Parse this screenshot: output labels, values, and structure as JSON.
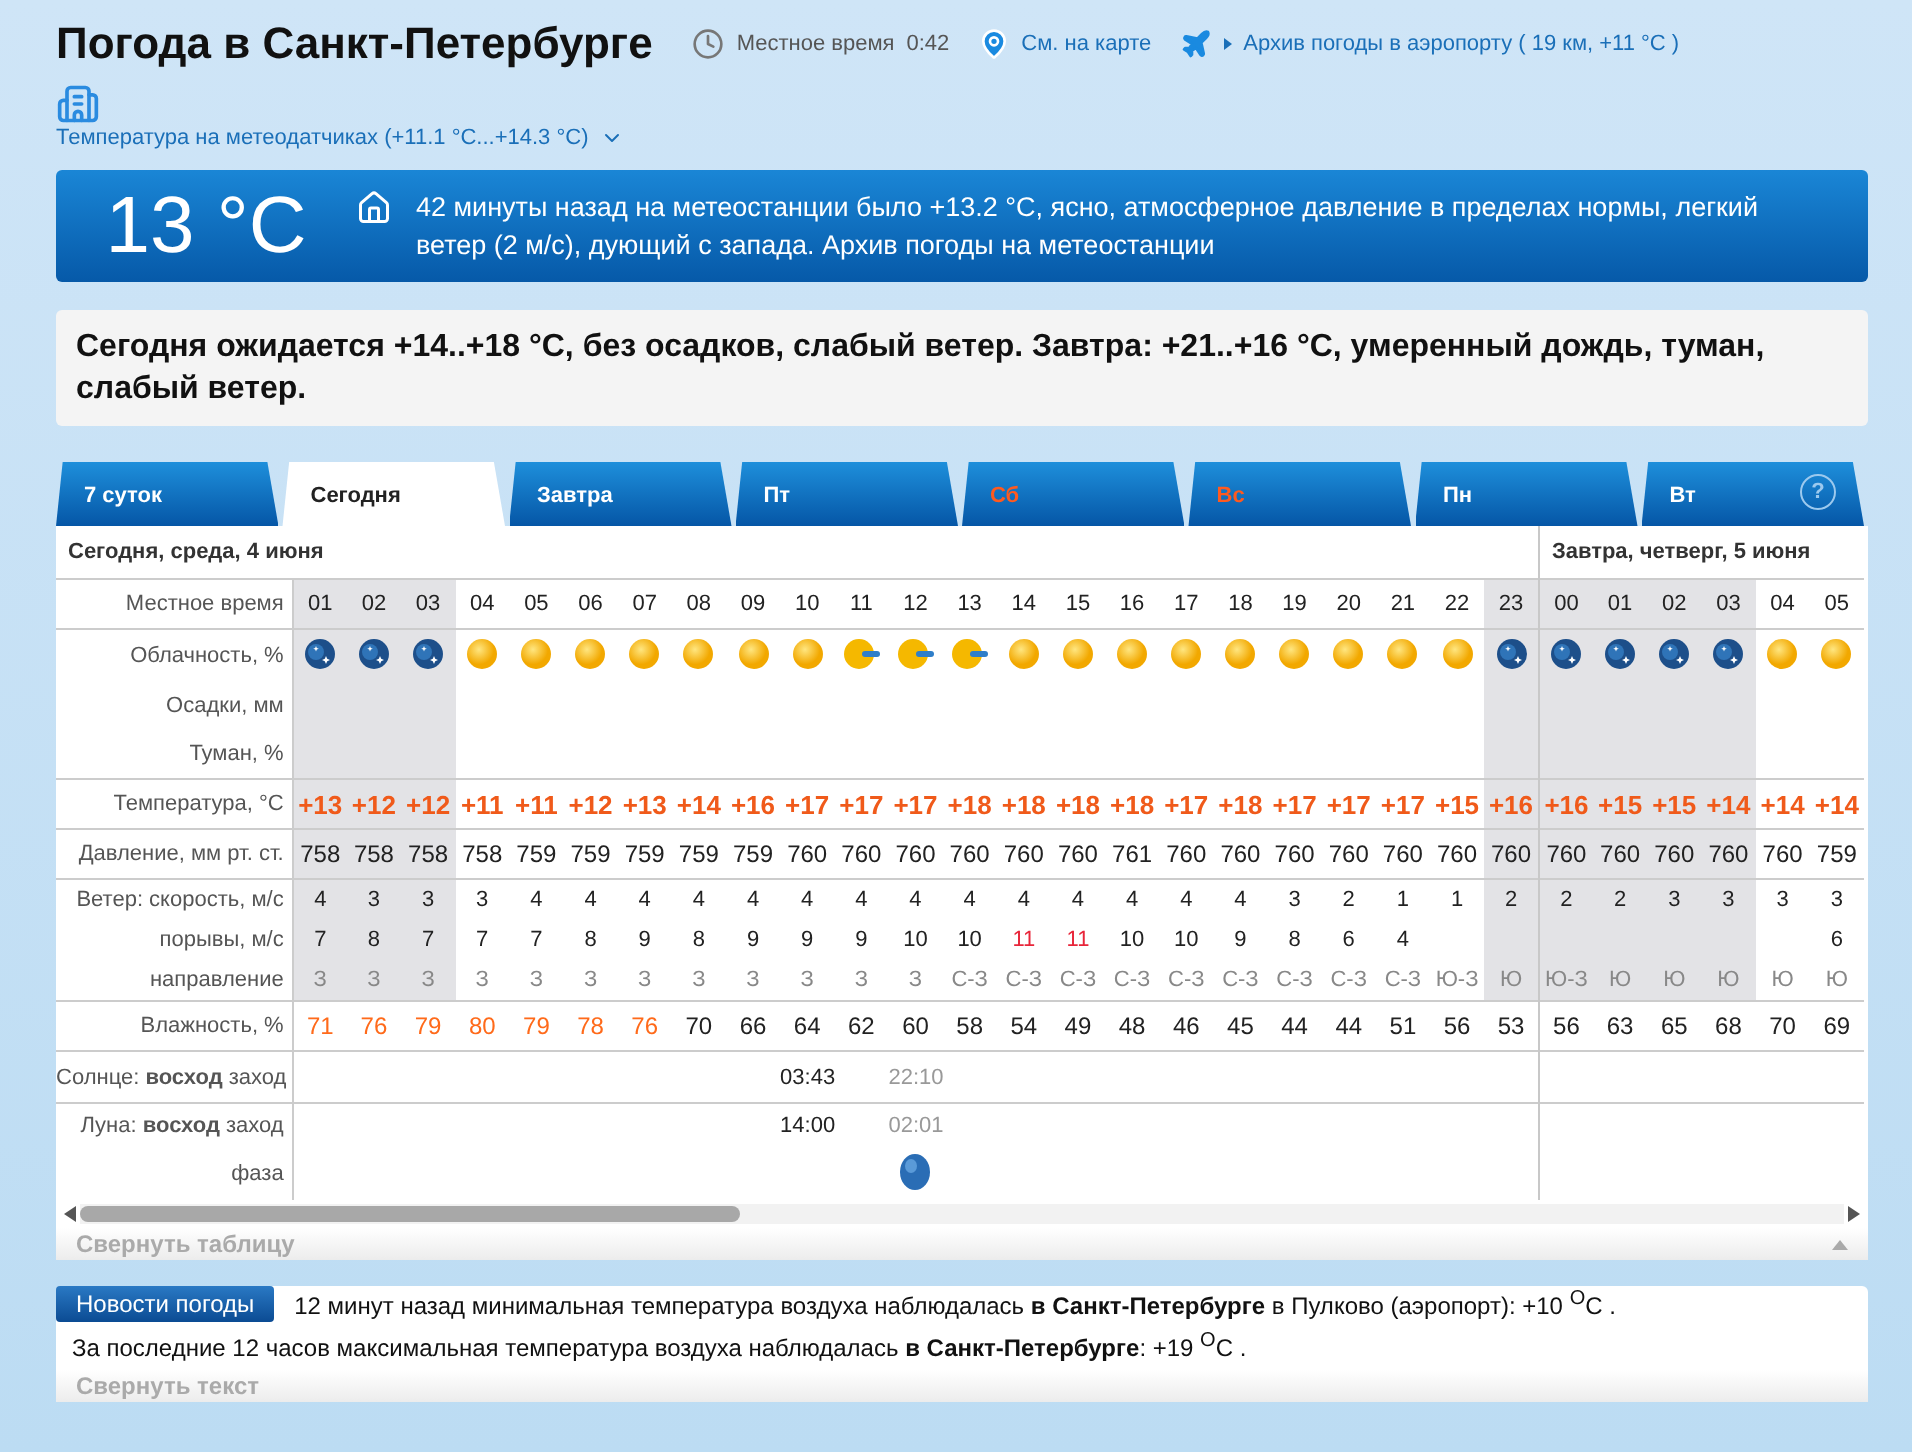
{
  "header": {
    "title": "Погода в Санкт-Петербурге",
    "local_time_label": "Местное время",
    "local_time": "0:42",
    "map_link": "См. на карте",
    "airport_link": "Архив погоды в аэропорту ( 19 км, +11 °C )",
    "sensors_link": "Температура на метеодатчиках (+11.1 °C...+14.3 °C)"
  },
  "current": {
    "temperature": "13 °C",
    "text": "42 минуты назад на метеостанции было +13.2 °C, ясно, атмосферное давление в пределах нормы, легкий ветер (2 м/с), дующий с запада.",
    "link": "Архив погоды на метеостанции"
  },
  "summary": "Сегодня ожидается +14..+18 °C, без осадков, слабый ветер. Завтра: +21..+16 °C, умеренный дождь, туман, слабый ветер.",
  "tabs": [
    {
      "label": "7 суток",
      "selected": false,
      "weekend": false
    },
    {
      "label": "Сегодня",
      "selected": true,
      "weekend": false
    },
    {
      "label": "Завтра",
      "selected": false,
      "weekend": false
    },
    {
      "label": "Пт",
      "selected": false,
      "weekend": false
    },
    {
      "label": "Сб",
      "selected": false,
      "weekend": true
    },
    {
      "label": "Вс",
      "selected": false,
      "weekend": true
    },
    {
      "label": "Пн",
      "selected": false,
      "weekend": false
    },
    {
      "label": "Вт",
      "selected": false,
      "weekend": false
    }
  ],
  "help_label": "?",
  "row_labels": {
    "time": "Местное время",
    "clouds": "Облачность, %",
    "precip": "Осадки, мм",
    "fog": "Туман, %",
    "temperature": "Температура, °C",
    "pressure": "Давление, мм рт. ст.",
    "wind": "Ветер: скорость, м/с",
    "gusts": "порывы, м/с",
    "direction": "направление",
    "humidity": "Влажность, %",
    "sun": "Солнце: **восход** заход",
    "moon": "Луна: **восход** заход",
    "phase": "фаза"
  },
  "days": [
    {
      "title": "Сегодня, среда, 4 июня",
      "columns": [
        {
          "hour": "01",
          "night": true,
          "kind": "night",
          "temp": "+13",
          "pressure": "758",
          "wind": "4",
          "gust": "7",
          "gust_strong": false,
          "dir": "З",
          "humidity": "71",
          "humid_high": true
        },
        {
          "hour": "02",
          "night": true,
          "kind": "night",
          "temp": "+12",
          "pressure": "758",
          "wind": "3",
          "gust": "8",
          "gust_strong": false,
          "dir": "З",
          "humidity": "76",
          "humid_high": true
        },
        {
          "hour": "03",
          "night": true,
          "kind": "night",
          "temp": "+12",
          "pressure": "758",
          "wind": "3",
          "gust": "7",
          "gust_strong": false,
          "dir": "З",
          "humidity": "79",
          "humid_high": true
        },
        {
          "hour": "04",
          "night": false,
          "kind": "clear",
          "temp": "+11",
          "pressure": "758",
          "wind": "3",
          "gust": "7",
          "gust_strong": false,
          "dir": "З",
          "humidity": "80",
          "humid_high": true
        },
        {
          "hour": "05",
          "night": false,
          "kind": "clear",
          "temp": "+11",
          "pressure": "759",
          "wind": "4",
          "gust": "7",
          "gust_strong": false,
          "dir": "З",
          "humidity": "79",
          "humid_high": true
        },
        {
          "hour": "06",
          "night": false,
          "kind": "clear",
          "temp": "+12",
          "pressure": "759",
          "wind": "4",
          "gust": "8",
          "gust_strong": false,
          "dir": "З",
          "humidity": "78",
          "humid_high": true
        },
        {
          "hour": "07",
          "night": false,
          "kind": "clear",
          "temp": "+13",
          "pressure": "759",
          "wind": "4",
          "gust": "9",
          "gust_strong": false,
          "dir": "З",
          "humidity": "76",
          "humid_high": true
        },
        {
          "hour": "08",
          "night": false,
          "kind": "clear",
          "temp": "+14",
          "pressure": "759",
          "wind": "4",
          "gust": "8",
          "gust_strong": false,
          "dir": "З",
          "humidity": "70",
          "humid_high": false
        },
        {
          "hour": "09",
          "night": false,
          "kind": "clear",
          "temp": "+16",
          "pressure": "759",
          "wind": "4",
          "gust": "9",
          "gust_strong": false,
          "dir": "З",
          "humidity": "66",
          "humid_high": false
        },
        {
          "hour": "10",
          "night": false,
          "kind": "clear",
          "temp": "+17",
          "pressure": "760",
          "wind": "4",
          "gust": "9",
          "gust_strong": false,
          "dir": "З",
          "humidity": "64",
          "humid_high": false,
          "sun": {
            "text": "03:43",
            "kind": "rise"
          },
          "moon": {
            "text": "14:00",
            "kind": "rise"
          }
        },
        {
          "hour": "11",
          "night": false,
          "kind": "partly",
          "temp": "+17",
          "pressure": "760",
          "wind": "4",
          "gust": "9",
          "gust_strong": false,
          "dir": "З",
          "humidity": "62",
          "humid_high": false
        },
        {
          "hour": "12",
          "night": false,
          "kind": "partly",
          "temp": "+17",
          "pressure": "760",
          "wind": "4",
          "gust": "10",
          "gust_strong": false,
          "dir": "З",
          "humidity": "60",
          "humid_high": false,
          "sun": {
            "text": "22:10",
            "kind": "set"
          },
          "moon": {
            "text": "02:01",
            "kind": "set"
          },
          "moon_phase": true
        },
        {
          "hour": "13",
          "night": false,
          "kind": "partly",
          "temp": "+18",
          "pressure": "760",
          "wind": "4",
          "gust": "10",
          "gust_strong": false,
          "dir": "С-З",
          "humidity": "58",
          "humid_high": false
        },
        {
          "hour": "14",
          "night": false,
          "kind": "clear",
          "temp": "+18",
          "pressure": "760",
          "wind": "4",
          "gust": "11",
          "gust_strong": true,
          "dir": "С-З",
          "humidity": "54",
          "humid_high": false
        },
        {
          "hour": "15",
          "night": false,
          "kind": "clear",
          "temp": "+18",
          "pressure": "760",
          "wind": "4",
          "gust": "11",
          "gust_strong": true,
          "dir": "С-З",
          "humidity": "49",
          "humid_high": false
        },
        {
          "hour": "16",
          "night": false,
          "kind": "clear",
          "temp": "+18",
          "pressure": "761",
          "wind": "4",
          "gust": "10",
          "gust_strong": false,
          "dir": "С-З",
          "humidity": "48",
          "humid_high": false
        },
        {
          "hour": "17",
          "night": false,
          "kind": "clear",
          "temp": "+17",
          "pressure": "760",
          "wind": "4",
          "gust": "10",
          "gust_strong": false,
          "dir": "С-З",
          "humidity": "46",
          "humid_high": false
        },
        {
          "hour": "18",
          "night": false,
          "kind": "clear",
          "temp": "+18",
          "pressure": "760",
          "wind": "4",
          "gust": "9",
          "gust_strong": false,
          "dir": "С-З",
          "humidity": "45",
          "humid_high": false
        },
        {
          "hour": "19",
          "night": false,
          "kind": "clear",
          "temp": "+17",
          "pressure": "760",
          "wind": "3",
          "gust": "8",
          "gust_strong": false,
          "dir": "С-З",
          "humidity": "44",
          "humid_high": false
        },
        {
          "hour": "20",
          "night": false,
          "kind": "clear",
          "temp": "+17",
          "pressure": "760",
          "wind": "2",
          "gust": "6",
          "gust_strong": false,
          "dir": "С-З",
          "humidity": "44",
          "humid_high": false
        },
        {
          "hour": "21",
          "night": false,
          "kind": "clear",
          "temp": "+17",
          "pressure": "760",
          "wind": "1",
          "gust": "4",
          "gust_strong": false,
          "dir": "С-З",
          "humidity": "51",
          "humid_high": false
        },
        {
          "hour": "22",
          "night": false,
          "kind": "clear",
          "temp": "+15",
          "pressure": "760",
          "wind": "1",
          "dir": "Ю-З",
          "humidity": "56",
          "humid_high": false
        },
        {
          "hour": "23",
          "night": true,
          "kind": "night",
          "temp": "+16",
          "pressure": "760",
          "wind": "2",
          "dir": "Ю",
          "humidity": "53",
          "humid_high": false
        }
      ]
    },
    {
      "title": "Завтра, четверг, 5 июня",
      "columns": [
        {
          "hour": "00",
          "night": true,
          "kind": "night",
          "temp": "+16",
          "pressure": "760",
          "wind": "2",
          "dir": "Ю-З",
          "humidity": "56",
          "humid_high": false
        },
        {
          "hour": "01",
          "night": true,
          "kind": "night",
          "temp": "+15",
          "pressure": "760",
          "wind": "2",
          "dir": "Ю",
          "humidity": "63",
          "humid_high": false
        },
        {
          "hour": "02",
          "night": true,
          "kind": "night",
          "temp": "+15",
          "pressure": "760",
          "wind": "3",
          "dir": "Ю",
          "humidity": "65",
          "humid_high": false
        },
        {
          "hour": "03",
          "night": true,
          "kind": "night",
          "temp": "+14",
          "pressure": "760",
          "wind": "3",
          "dir": "Ю",
          "humidity": "68",
          "humid_high": false
        },
        {
          "hour": "04",
          "night": false,
          "kind": "clear",
          "temp": "+14",
          "pressure": "760",
          "wind": "3",
          "dir": "Ю",
          "humidity": "70",
          "humid_high": false
        },
        {
          "hour": "05",
          "night": false,
          "kind": "clear",
          "temp": "+14",
          "pressure": "759",
          "wind": "3",
          "gust": "6",
          "gust_strong": false,
          "dir": "Ю",
          "humidity": "69",
          "humid_high": false
        }
      ]
    }
  ],
  "collapse_table": "Свернуть таблицу",
  "news": {
    "badge": "Новости погоды",
    "items": [
      "12 минут назад минимальная температура воздуха наблюдалась **в Санкт-Петербурге** в Пулково (аэропорт): +10 $^{O}$C .",
      "За последние 12 часов максимальная температура воздуха наблюдалась **в Санкт-Петербурге**: +19 $^{O}$C ."
    ],
    "collapse": "Свернуть текст"
  }
}
